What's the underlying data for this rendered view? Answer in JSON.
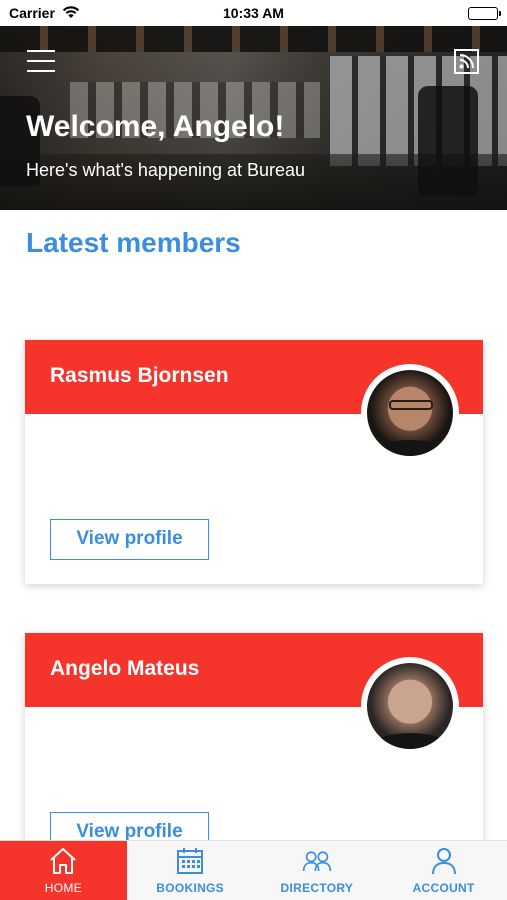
{
  "status_bar": {
    "carrier": "Carrier",
    "time": "10:33 AM"
  },
  "hero": {
    "title": "Welcome, Angelo!",
    "subtitle": "Here's what's happening at Bureau",
    "menu_icon": "hamburger-menu-icon",
    "feed_icon": "rss-feed-icon"
  },
  "section": {
    "title": "Latest members"
  },
  "members": [
    {
      "name": "Rasmus Bjornsen",
      "action_label": "View profile"
    },
    {
      "name": "Angelo Mateus",
      "action_label": "View profile"
    }
  ],
  "bottom_nav": {
    "items": [
      {
        "label": "HOME",
        "icon": "home-icon",
        "active": true
      },
      {
        "label": "BOOKINGS",
        "icon": "calendar-icon",
        "active": false
      },
      {
        "label": "DIRECTORY",
        "icon": "people-icon",
        "active": false
      },
      {
        "label": "ACCOUNT",
        "icon": "user-icon",
        "active": false
      }
    ]
  },
  "colors": {
    "accent_red": "#f5342c",
    "accent_blue": "#3b8de0"
  }
}
